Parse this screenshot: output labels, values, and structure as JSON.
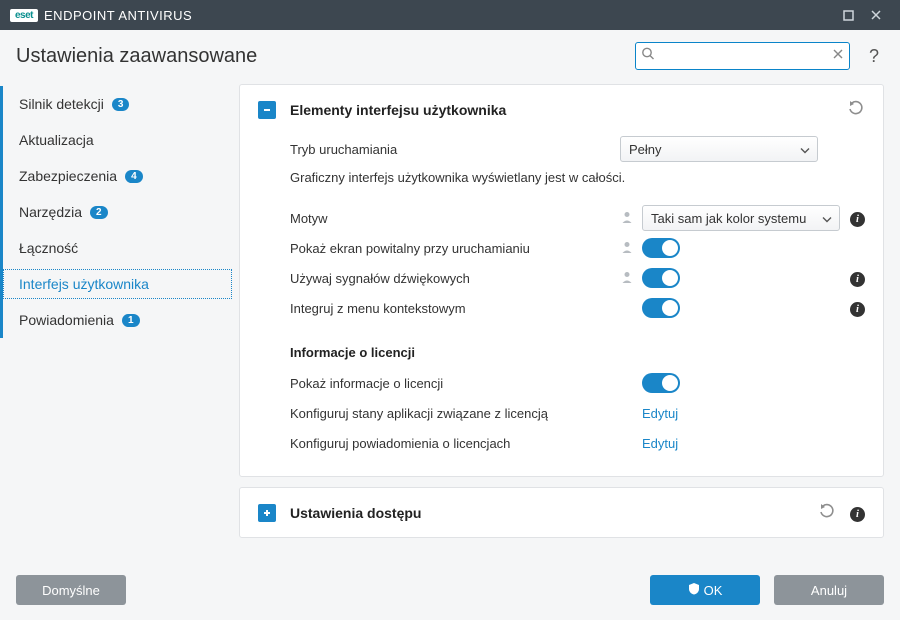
{
  "titlebar": {
    "brand": "eset",
    "product": "ENDPOINT ANTIVIRUS"
  },
  "header": {
    "title": "Ustawienia zaawansowane",
    "search_placeholder": ""
  },
  "sidebar": {
    "items": [
      {
        "label": "Silnik detekcji",
        "badge": "3",
        "accent": true
      },
      {
        "label": "Aktualizacja",
        "badge": "",
        "accent": true
      },
      {
        "label": "Zabezpieczenia",
        "badge": "4",
        "accent": true
      },
      {
        "label": "Narzędzia",
        "badge": "2",
        "accent": true
      },
      {
        "label": "Łączność",
        "badge": "",
        "accent": true
      },
      {
        "label": "Interfejs użytkownika",
        "badge": "",
        "accent": true,
        "active": true
      },
      {
        "label": "Powiadomienia",
        "badge": "1",
        "accent": true
      }
    ]
  },
  "panel_ui": {
    "title": "Elementy interfejsu użytkownika",
    "startup_mode_label": "Tryb uruchamiania",
    "startup_mode_value": "Pełny",
    "startup_mode_note": "Graficzny interfejs użytkownika wyświetlany jest w całości.",
    "theme_label": "Motyw",
    "theme_value": "Taki sam jak kolor systemu",
    "splash_label": "Pokaż ekran powitalny przy uruchamianiu",
    "sounds_label": "Używaj sygnałów dźwiękowych",
    "context_label": "Integruj z menu kontekstowym",
    "license_section": "Informacje o licencji",
    "show_license_label": "Pokaż informacje o licencji",
    "configure_states_label": "Konfiguruj stany aplikacji związane z licencją",
    "configure_notifs_label": "Konfiguruj powiadomienia o licencjach",
    "edit_link": "Edytuj"
  },
  "panel_access": {
    "title": "Ustawienia dostępu"
  },
  "footer": {
    "defaults": "Domyślne",
    "ok": "OK",
    "cancel": "Anuluj"
  }
}
